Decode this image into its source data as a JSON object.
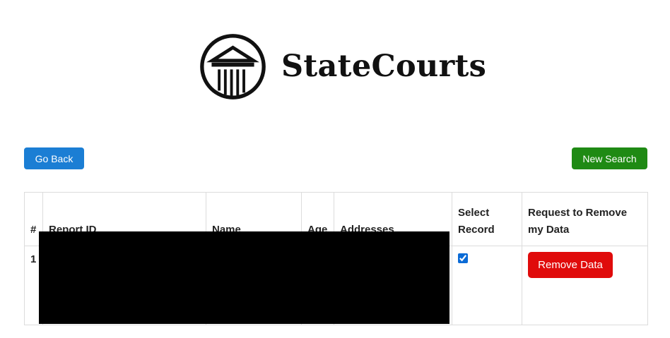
{
  "brand": {
    "name": "StateCourts",
    "logo_icon": "courthouse-pillars-icon"
  },
  "nav": {
    "back_label": "Go Back",
    "new_search_label": "New Search"
  },
  "colors": {
    "back_button": "#1b7ed4",
    "new_search_button": "#1f8a14",
    "remove_button": "#e00b0b",
    "redaction": "#000000"
  },
  "table": {
    "headers": {
      "num": "#",
      "report_id": "Report ID",
      "name": "Name",
      "age": "Age",
      "addresses": "Addresses",
      "select_record": "Select Record",
      "request_remove": "Request to Remove my Data"
    },
    "rows": [
      {
        "num": "1",
        "report_id": "",
        "name": "",
        "age": "",
        "addresses": "",
        "selected": true,
        "remove_label": "Remove Data"
      }
    ]
  }
}
